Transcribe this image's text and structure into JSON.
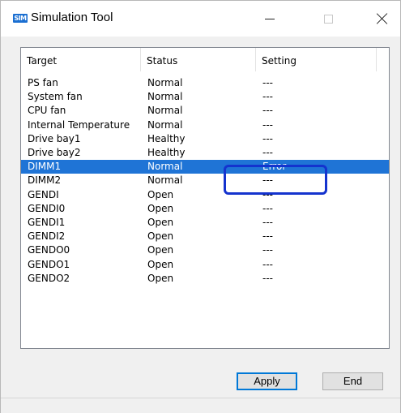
{
  "window": {
    "icon_text": "SIM",
    "title": "Simulation Tool"
  },
  "list": {
    "columns": [
      "Target",
      "Status",
      "Setting"
    ],
    "rows": [
      {
        "target": "PS fan",
        "status": "Normal",
        "setting": "---"
      },
      {
        "target": "System fan",
        "status": "Normal",
        "setting": "---"
      },
      {
        "target": "CPU fan",
        "status": "Normal",
        "setting": "---"
      },
      {
        "target": "Internal Temperature",
        "status": "Normal",
        "setting": "---"
      },
      {
        "target": "Drive bay1",
        "status": "Healthy",
        "setting": "---"
      },
      {
        "target": "Drive bay2",
        "status": "Healthy",
        "setting": "---"
      },
      {
        "target": "DIMM1",
        "status": "Normal",
        "setting": "Error"
      },
      {
        "target": "DIMM2",
        "status": "Normal",
        "setting": "---"
      },
      {
        "target": "GENDI",
        "status": "Open",
        "setting": "---"
      },
      {
        "target": "GENDI0",
        "status": "Open",
        "setting": "---"
      },
      {
        "target": "GENDI1",
        "status": "Open",
        "setting": "---"
      },
      {
        "target": "GENDI2",
        "status": "Open",
        "setting": "---"
      },
      {
        "target": "GENDO0",
        "status": "Open",
        "setting": "---"
      },
      {
        "target": "GENDO1",
        "status": "Open",
        "setting": "---"
      },
      {
        "target": "GENDO2",
        "status": "Open",
        "setting": "---"
      }
    ],
    "selected_row": "DIMM1"
  },
  "buttons": {
    "apply": "Apply",
    "end": "End"
  },
  "colors": {
    "selection": "#1f74d6",
    "highlight_border": "#1433ce",
    "default_button_border": "#0078d7"
  }
}
